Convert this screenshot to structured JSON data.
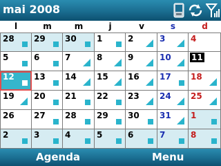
{
  "header": {
    "title": "mai 2008",
    "status_icons": [
      "phone-icon",
      "sync-icon",
      "signal-icon"
    ]
  },
  "weekdays": [
    {
      "label": "l",
      "kind": "weekday"
    },
    {
      "label": "m",
      "kind": "weekday"
    },
    {
      "label": "m",
      "kind": "weekday"
    },
    {
      "label": "j",
      "kind": "weekday"
    },
    {
      "label": "v",
      "kind": "weekday"
    },
    {
      "label": "s",
      "kind": "saturday"
    },
    {
      "label": "d",
      "kind": "sunday"
    }
  ],
  "weeks": [
    [
      {
        "d": "28",
        "other": true,
        "mark": "square"
      },
      {
        "d": "29",
        "other": true,
        "mark": "square"
      },
      {
        "d": "30",
        "other": true,
        "mark": "square"
      },
      {
        "d": "1",
        "mark": "square"
      },
      {
        "d": "2",
        "mark": "triangle"
      },
      {
        "d": "3",
        "mark": "triangle"
      },
      {
        "d": "4",
        "mark": "none"
      }
    ],
    [
      {
        "d": "5",
        "mark": "square"
      },
      {
        "d": "6",
        "mark": "square"
      },
      {
        "d": "7",
        "mark": "triangle"
      },
      {
        "d": "8",
        "mark": "triangle"
      },
      {
        "d": "9",
        "mark": "triangle"
      },
      {
        "d": "10",
        "mark": "triangle"
      },
      {
        "d": "11",
        "mark": "none",
        "today": true
      }
    ],
    [
      {
        "d": "12",
        "mark": "square",
        "selected": true
      },
      {
        "d": "13",
        "mark": "square"
      },
      {
        "d": "14",
        "mark": "triangle"
      },
      {
        "d": "15",
        "mark": "triangle"
      },
      {
        "d": "16",
        "mark": "triangle"
      },
      {
        "d": "17",
        "mark": "square"
      },
      {
        "d": "18",
        "mark": "triangle"
      }
    ],
    [
      {
        "d": "19",
        "mark": "triangle"
      },
      {
        "d": "20",
        "mark": "square"
      },
      {
        "d": "21",
        "mark": "square"
      },
      {
        "d": "22",
        "mark": "square"
      },
      {
        "d": "23",
        "mark": "triangle"
      },
      {
        "d": "24",
        "mark": "triangle"
      },
      {
        "d": "25",
        "mark": "triangle"
      }
    ],
    [
      {
        "d": "26",
        "mark": "none"
      },
      {
        "d": "27",
        "mark": "square"
      },
      {
        "d": "28",
        "mark": "square"
      },
      {
        "d": "29",
        "mark": "square"
      },
      {
        "d": "30",
        "mark": "square"
      },
      {
        "d": "31",
        "mark": "triangle"
      },
      {
        "d": "1",
        "other": true,
        "mark": "square"
      }
    ],
    [
      {
        "d": "2",
        "other": true,
        "mark": "square"
      },
      {
        "d": "3",
        "other": true,
        "mark": "square"
      },
      {
        "d": "4",
        "other": true,
        "mark": "square"
      },
      {
        "d": "5",
        "other": true,
        "mark": "square"
      },
      {
        "d": "6",
        "other": true,
        "mark": "square"
      },
      {
        "d": "7",
        "other": true,
        "mark": "square"
      },
      {
        "d": "8",
        "other": true,
        "mark": "square"
      }
    ]
  ],
  "softkeys": {
    "left": "Agenda",
    "right": "Menu"
  },
  "colors": {
    "bar": "#1a6d90",
    "marker": "#2ab4cc",
    "other_month_bg": "#d6ecf2",
    "saturday": "#1a2eb0",
    "sunday": "#c41c1c",
    "selection_border": "#e04d4d"
  }
}
